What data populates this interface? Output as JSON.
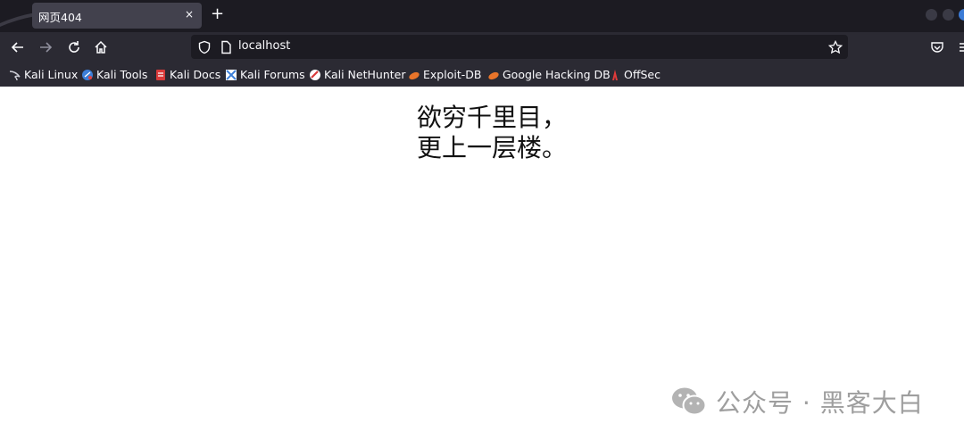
{
  "browser": {
    "tab": {
      "title": "网页404",
      "close_glyph": "×"
    },
    "new_tab_glyph": "+",
    "url": "localhost",
    "bookmarks": [
      {
        "label": "Kali Linux",
        "icon": "kali-dragon-icon"
      },
      {
        "label": "Kali Tools",
        "icon": "kali-tools-icon"
      },
      {
        "label": "Kali Docs",
        "icon": "kali-docs-icon"
      },
      {
        "label": "Kali Forums",
        "icon": "kali-forums-icon"
      },
      {
        "label": "Kali NetHunter",
        "icon": "kali-nethunter-icon"
      },
      {
        "label": "Exploit-DB",
        "icon": "exploit-db-icon"
      },
      {
        "label": "Google Hacking DB",
        "icon": "google-hacking-db-icon"
      },
      {
        "label": "OffSec",
        "icon": "offsec-icon"
      }
    ]
  },
  "page": {
    "line1": "欲穷千里目，",
    "line2": "更上一层楼。"
  },
  "watermark": {
    "text": "公众号 · 黑客大白",
    "icon": "wechat-icon"
  },
  "colors": {
    "tabstrip": "#1c1b22",
    "toolbar": "#2b2a33",
    "active_tab": "#42414d",
    "urlbar": "#1c1b22",
    "text_light": "#fbfbfe",
    "watermark": "#9e9e9e"
  }
}
